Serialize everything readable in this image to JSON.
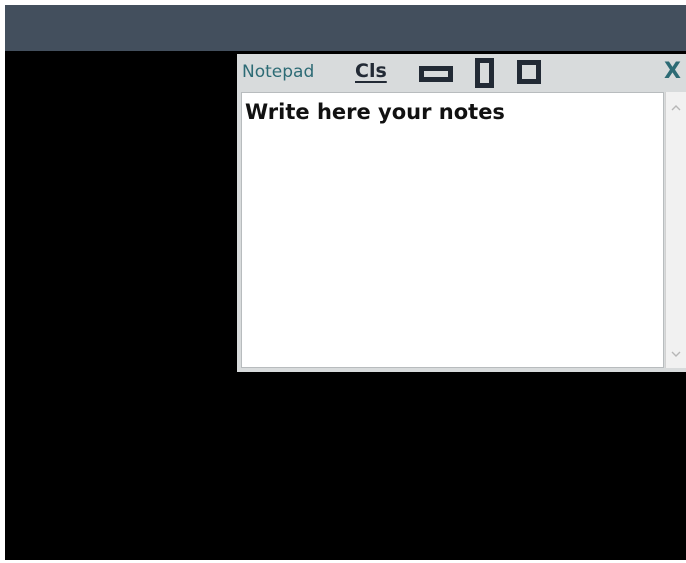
{
  "notepad": {
    "title": "Notepad",
    "clear_label": "Cls",
    "layout_buttons": [
      {
        "icon": "wide-layout-icon"
      },
      {
        "icon": "tall-layout-icon"
      },
      {
        "icon": "square-layout-icon"
      }
    ],
    "close_label": "X",
    "editor_text": "Write here your notes"
  },
  "colors": {
    "window_title_bar": "#434f5d",
    "background": "#000000",
    "notepad_panel": "#d8dbdc",
    "notepad_title": "#2d6b75",
    "toolbar_icon": "#222a35"
  }
}
